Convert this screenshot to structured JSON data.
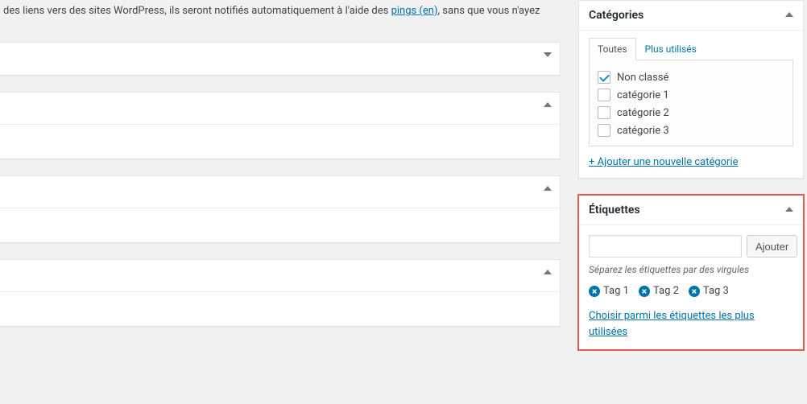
{
  "intro": {
    "prefix": "des liens vers des sites WordPress, ils seront notifiés automatiquement à l'aide des ",
    "link_text": "pings (en)",
    "suffix": ", sans que vous n'ayez"
  },
  "sidebar": {
    "categories": {
      "title": "Catégories",
      "tabs": {
        "all": "Toutes",
        "most_used": "Plus utilisés"
      },
      "items": [
        {
          "label": "Non classé",
          "checked": true
        },
        {
          "label": "catégorie 1",
          "checked": false
        },
        {
          "label": "catégorie 2",
          "checked": false
        },
        {
          "label": "catégorie 3",
          "checked": false
        }
      ],
      "add_link": "+ Ajouter une nouvelle catégorie"
    },
    "tags": {
      "title": "Étiquettes",
      "add_button": "Ajouter",
      "hint": "Séparez les étiquettes par des virgules",
      "items": [
        "Tag 1",
        "Tag 2",
        "Tag 3"
      ],
      "choose_link": "Choisir parmi les étiquettes les plus utilisées"
    }
  }
}
